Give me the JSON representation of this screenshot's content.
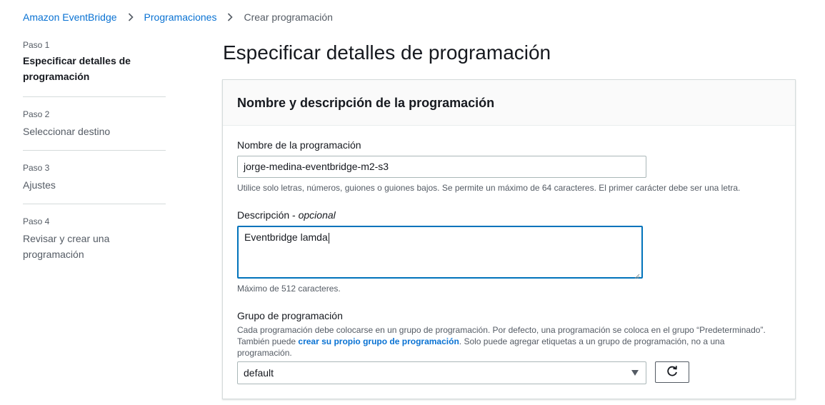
{
  "breadcrumb": {
    "items": [
      "Amazon EventBridge",
      "Programaciones"
    ],
    "current": "Crear programación"
  },
  "steps": [
    {
      "label": "Paso 1",
      "title": "Especificar detalles de programación"
    },
    {
      "label": "Paso 2",
      "title": "Seleccionar destino"
    },
    {
      "label": "Paso 3",
      "title": "Ajustes"
    },
    {
      "label": "Paso 4",
      "title": "Revisar y crear una programación"
    }
  ],
  "page_title": "Especificar detalles de programación",
  "panel": {
    "title": "Nombre y descripción de la programación",
    "name_field": {
      "label": "Nombre de la programación",
      "value": "jorge-medina-eventbridge-m2-s3",
      "hint": "Utilice solo letras, números, guiones o guiones bajos. Se permite un máximo de 64 caracteres. El primer carácter debe ser una letra."
    },
    "description_field": {
      "label": "Descripción",
      "label_sep": " - ",
      "label_optional": "opcional",
      "value": "Eventbridge lamda",
      "hint": "Máximo de 512 caracteres."
    },
    "group_field": {
      "label": "Grupo de programación",
      "hint_line1": "Cada programación debe colocarse en un grupo de programación. Por defecto, una programación se coloca en el grupo “Predeterminado”.",
      "hint_line2_before": "También puede ",
      "hint_link": "crear su propio grupo de programación",
      "hint_line2_after": ". Solo puede agregar etiquetas a un grupo de programación, no a una",
      "hint_line3": "programación.",
      "selected": "default"
    }
  },
  "colors": {
    "link": "#0972d3",
    "focus_border": "#0073bb",
    "text": "#16191f",
    "muted": "#545b64"
  }
}
